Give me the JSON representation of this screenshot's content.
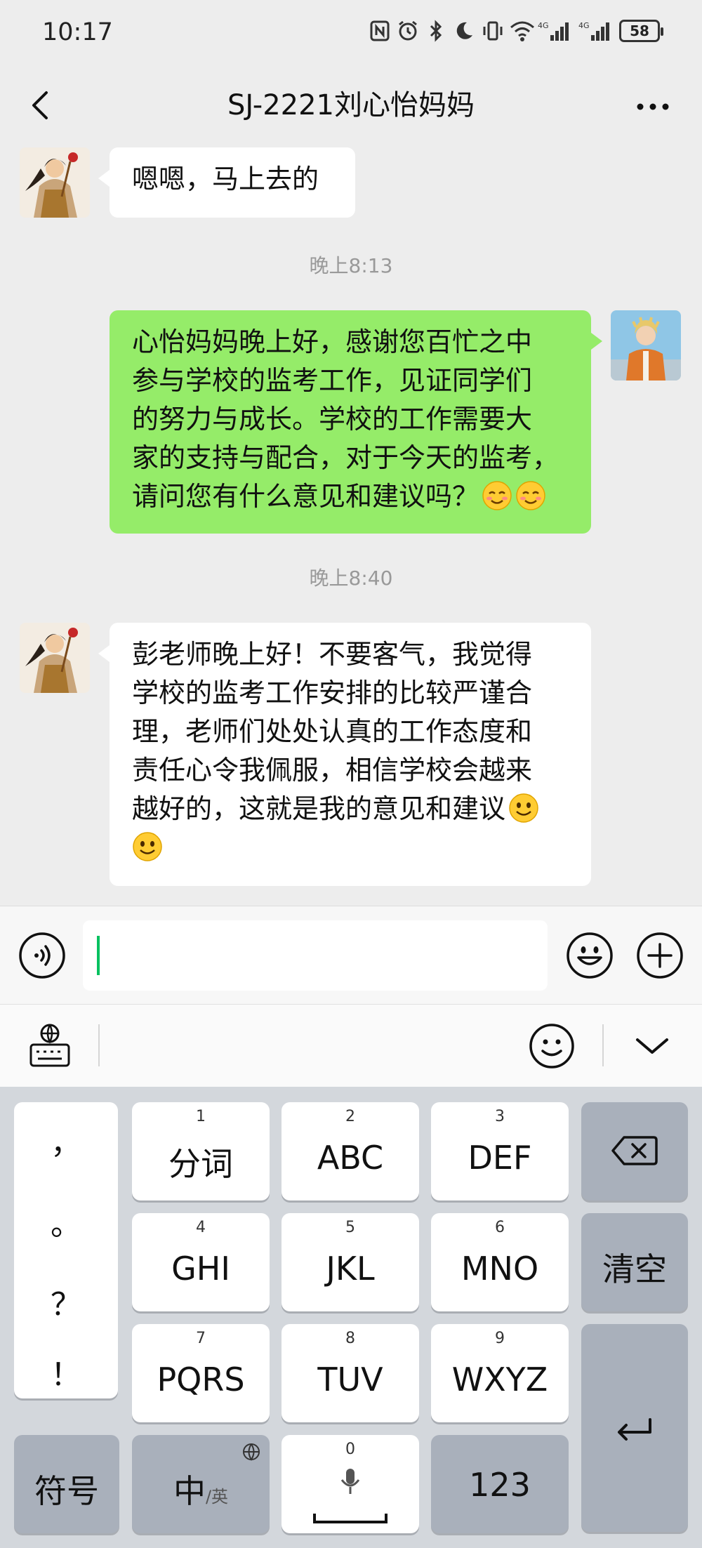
{
  "status_bar": {
    "time": "10:17",
    "battery": "58",
    "icons": [
      "nfc-icon",
      "alarm-icon",
      "bluetooth-icon",
      "moon-icon",
      "vibrate-icon",
      "wifi-icon",
      "signal-4g-icon",
      "signal-4g-icon"
    ]
  },
  "header": {
    "title": "SJ-2221刘心怡妈妈",
    "back_icon": "back-arrow-icon",
    "more_icon": "more-dots-icon"
  },
  "messages": [
    {
      "from": "other",
      "text": "嗯嗯，马上去的"
    },
    {
      "type": "time",
      "text": "晚上8:13"
    },
    {
      "from": "me",
      "lines": [
        "心怡妈妈晚上好，感谢您百忙之中",
        "参与学校的监考工作，见证同学们",
        "的努力与成长。学校的工作需要大",
        "家的支持与配合，对于今天的监考，",
        "请问您有什么意见和建议吗？"
      ],
      "emojis": [
        "blush",
        "blush"
      ]
    },
    {
      "type": "time",
      "text": "晚上8:40"
    },
    {
      "from": "other",
      "lines": [
        "彭老师晚上好！不要客气，我觉得",
        "学校的监考工作安排的比较严谨合",
        "理，老师们处处认真的工作态度和",
        "责任心令我佩服，相信学校会越来",
        "越好的，这就是我的意见和建议"
      ],
      "emojis": [
        "smile",
        "smile"
      ]
    }
  ],
  "input_bar": {
    "value": "",
    "icons": [
      "voice-icon",
      "emoji-icon",
      "plus-icon"
    ]
  },
  "keyboard": {
    "toolbar_icons": [
      "keyboard-settings-icon",
      "smile-icon",
      "chevron-down-icon"
    ],
    "punctuation": [
      "，",
      "。",
      "？",
      "！"
    ],
    "keys": [
      {
        "num": "1",
        "label": "分词"
      },
      {
        "num": "2",
        "label": "ABC"
      },
      {
        "num": "3",
        "label": "DEF"
      },
      {
        "num": "4",
        "label": "GHI"
      },
      {
        "num": "5",
        "label": "JKL"
      },
      {
        "num": "6",
        "label": "MNO"
      },
      {
        "num": "7",
        "label": "PQRS"
      },
      {
        "num": "8",
        "label": "TUV"
      },
      {
        "num": "9",
        "label": "WXYZ"
      }
    ],
    "clear_label": "清空",
    "symbols_label": "符号",
    "zh_label": "中",
    "zh_sub_label": "/英",
    "space_num": "0",
    "num_label": "123"
  }
}
